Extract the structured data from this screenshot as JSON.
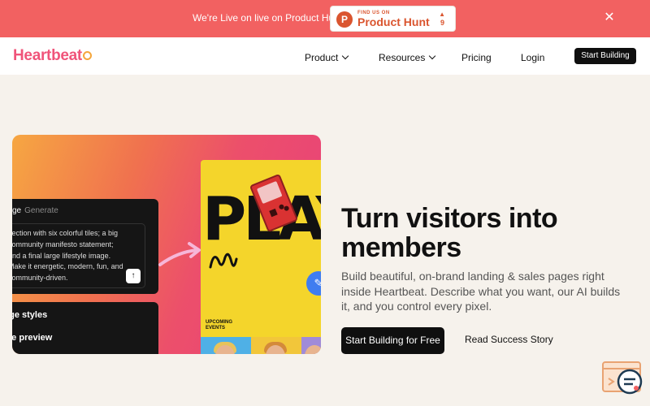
{
  "announcement": {
    "text": "We're Live on live on Product Hunt",
    "badge_small": "FIND US ON",
    "badge_big": "Product Hunt",
    "badge_letter": "P",
    "badge_count": "9",
    "close_icon": "close-icon"
  },
  "nav": {
    "logo": "Heartbeat",
    "items": [
      {
        "label": "Product",
        "has_dropdown": true
      },
      {
        "label": "Resources",
        "has_dropdown": true
      },
      {
        "label": "Pricing",
        "has_dropdown": false
      },
      {
        "label": "Login",
        "has_dropdown": false
      }
    ],
    "cta": "Start Building"
  },
  "hero_image": {
    "prompt_tab_active": "ge",
    "prompt_tab_other": "Generate",
    "prompt_text": "section with six colorful tiles; a big\ncommunity manifesto statement;\nand a final large lifestyle image.\nMake it energetic, modern, fun, and\ncommunity-driven.",
    "styles_lines": [
      "age styles",
      "ive preview"
    ],
    "play_word": "PLAY",
    "upcoming": "UPCOMING\nEVENTS"
  },
  "hero": {
    "title": "Turn visitors into members",
    "subtitle": "Build beautiful, on-brand landing & sales pages right inside Heartbeat. Describe what you want, our AI builds it, and you control every pixel.",
    "cta_primary": "Start Building for Free",
    "cta_secondary": "Read Success Story"
  },
  "colors": {
    "announcement_bg": "#f26161",
    "brand_pink": "#f0547a",
    "product_hunt": "#da552f"
  }
}
